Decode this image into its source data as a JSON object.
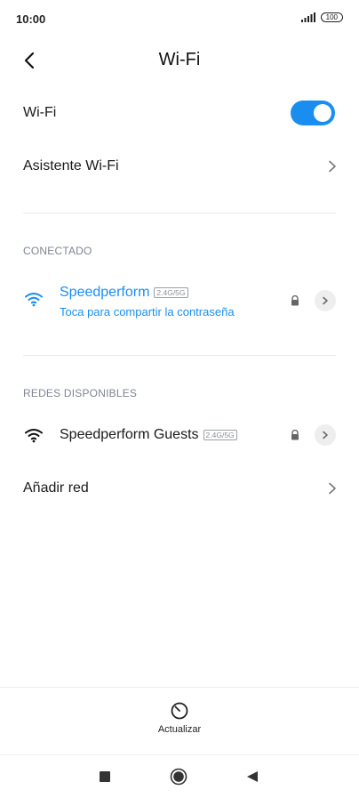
{
  "status_bar": {
    "time": "10:00",
    "battery": "100"
  },
  "header": {
    "title": "Wi-Fi"
  },
  "wifi_toggle": {
    "label": "Wi-Fi",
    "enabled": true
  },
  "assistant": {
    "label": "Asistente Wi-Fi"
  },
  "connected_section": {
    "heading": "CONECTADO",
    "network": {
      "name": "Speedperform",
      "band": "2.4G/5G",
      "subtitle": "Toca para compartir la contraseña",
      "secured": true
    }
  },
  "available_section": {
    "heading": "REDES DISPONIBLES",
    "networks": [
      {
        "name": "Speedperform Guests",
        "band": "2.4G/5G",
        "secured": true
      }
    ]
  },
  "add_network": {
    "label": "Añadir red"
  },
  "bottom": {
    "refresh_label": "Actualizar"
  },
  "colors": {
    "accent": "#1a8ef0",
    "section_text": "#7f8590"
  },
  "icons": [
    "back-arrow-icon",
    "wifi-icon",
    "lock-icon",
    "chevron-right-icon",
    "refresh-icon",
    "square-nav-icon",
    "home-nav-icon",
    "back-nav-icon",
    "signal-icon",
    "battery-icon"
  ]
}
